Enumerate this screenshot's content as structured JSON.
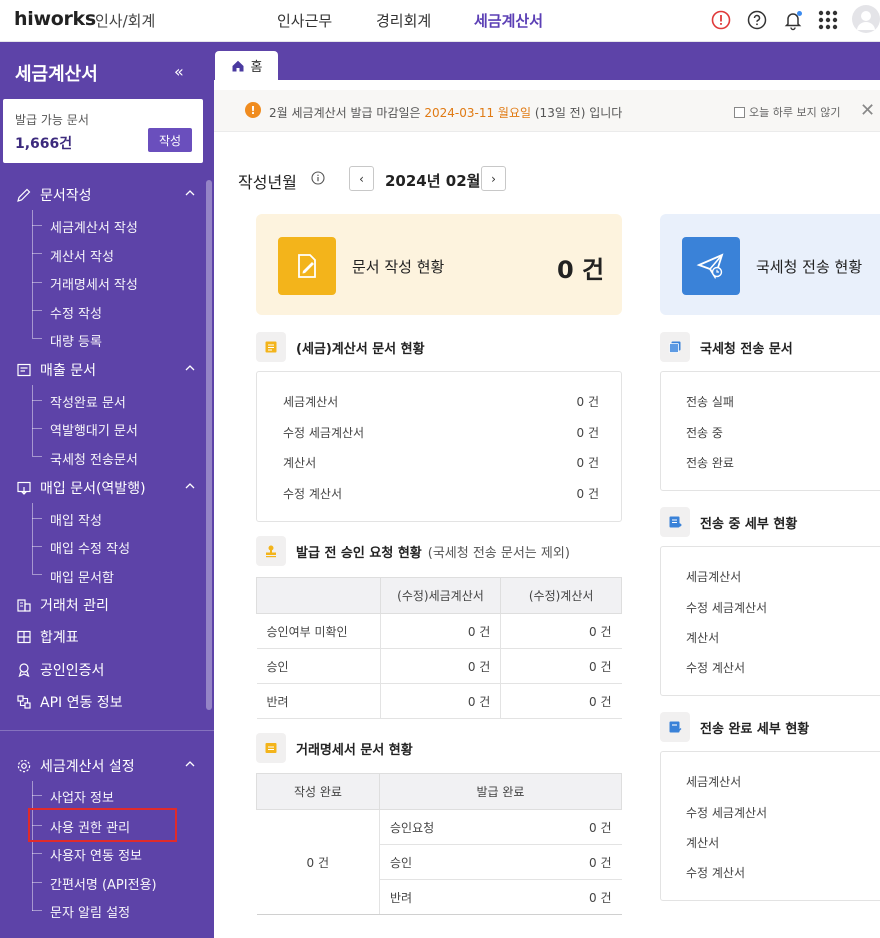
{
  "topbar": {
    "logo": "hiworks",
    "logo_sub": "인사/회계",
    "nav": [
      "인사근무",
      "경리회계",
      "세금계산서"
    ],
    "active_nav": "세금계산서",
    "accent": "#5b3fb5"
  },
  "sidebar": {
    "title": "세금계산서",
    "collapse": "«",
    "issue_label": "발급 가능 문서",
    "issue_count": "1,666건",
    "issue_button": "작성",
    "sections": [
      {
        "label": "문서작성",
        "items": [
          "세금계산서 작성",
          "계산서 작성",
          "거래명세서 작성",
          "수정 작성",
          "대량 등록"
        ]
      },
      {
        "label": "매출 문서",
        "items": [
          "작성완료 문서",
          "역발행대기 문서",
          "국세청 전송문서"
        ]
      },
      {
        "label": "매입 문서(역발행)",
        "items": [
          "매입 작성",
          "매입 수정 작성",
          "매입 문서함"
        ]
      },
      {
        "label": "거래처 관리",
        "items": []
      },
      {
        "label": "합계표",
        "items": []
      },
      {
        "label": "공인인증서",
        "items": []
      },
      {
        "label": "API 연동 정보",
        "items": []
      },
      {
        "label": "세금계산서 설정",
        "items": [
          "사업자 정보",
          "사용 권한 관리",
          "사용자 연동 정보",
          "간편서명 (API전용)",
          "문자 알림 설정"
        ]
      }
    ],
    "bg": "#5d43a8"
  },
  "tabs": {
    "home": "홈"
  },
  "notice": {
    "text_pre": "2월 세금계산서 발급 마감일은 ",
    "text_date": "2024-03-11 월요일",
    "text_post": " (13일 전) 입니다",
    "checkbox_label": "오늘 하루 보지 않기",
    "close": "✕",
    "accent": "#e07a13"
  },
  "period": {
    "label": "작성년월",
    "value": "2024년 02월",
    "prev": "‹",
    "next": "›"
  },
  "doc_status": {
    "title": "문서 작성 현황",
    "count": "0 건"
  },
  "nts_status": {
    "title": "국세청 전송 현황"
  },
  "invoice_status": {
    "title": "(세금)계산서 문서 현황",
    "rows": [
      {
        "label": "세금계산서",
        "value": "0 건"
      },
      {
        "label": "수정 세금계산서",
        "value": "0 건"
      },
      {
        "label": "계산서",
        "value": "0 건"
      },
      {
        "label": "수정 계산서",
        "value": "0 건"
      }
    ]
  },
  "approval": {
    "title": "발급 전 승인 요청 현황",
    "subtitle": "(국세청 전송 문서는 제외)",
    "headers": [
      "",
      "(수정)세금계산서",
      "(수정)계산서"
    ],
    "rows": [
      {
        "label": "승인여부 미확인",
        "a": "0 건",
        "b": "0 건"
      },
      {
        "label": "승인",
        "a": "0 건",
        "b": "0 건"
      },
      {
        "label": "반려",
        "a": "0 건",
        "b": "0 건"
      }
    ]
  },
  "statement": {
    "title": "거래명세서 문서 현황",
    "headers": [
      "작성 완료",
      "발급 완료"
    ],
    "written": "0 건",
    "rows": [
      {
        "label": "승인요청",
        "value": "0 건"
      },
      {
        "label": "승인",
        "value": "0 건"
      },
      {
        "label": "반려",
        "value": "0 건"
      }
    ]
  },
  "nts_docs": {
    "title": "국세청 전송 문서",
    "rows": [
      "전송 실패",
      "전송 중",
      "전송 완료"
    ]
  },
  "sending_detail": {
    "title": "전송 중 세부 현황",
    "rows": [
      "세금계산서",
      "수정 세금계산서",
      "계산서",
      "수정 계산서"
    ]
  },
  "done_detail": {
    "title": "전송 완료 세부 현황",
    "rows": [
      "세금계산서",
      "수정 세금계산서",
      "계산서",
      "수정 계산서"
    ]
  }
}
